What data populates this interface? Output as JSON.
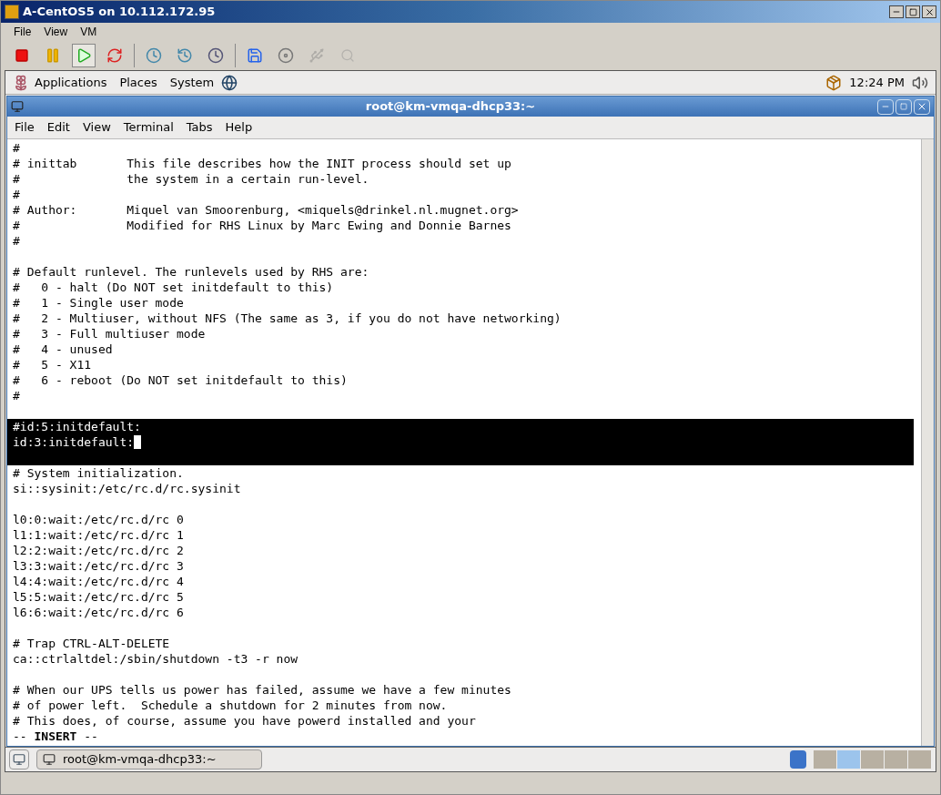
{
  "vm_window": {
    "title": "A-CentOS5 on 10.112.172.95",
    "menu": [
      "File",
      "View",
      "VM"
    ],
    "toolbar": [
      {
        "kind": "stop",
        "selected": false,
        "disabled": false
      },
      {
        "kind": "pause",
        "selected": false,
        "disabled": false
      },
      {
        "kind": "play",
        "selected": true,
        "disabled": false
      },
      {
        "kind": "reset",
        "selected": false,
        "disabled": false
      },
      {
        "kind": "snapshot",
        "selected": false,
        "disabled": false
      },
      {
        "kind": "revert",
        "selected": false,
        "disabled": false
      },
      {
        "kind": "manager",
        "selected": false,
        "disabled": false
      },
      {
        "kind": "settings",
        "selected": false,
        "disabled": false
      },
      {
        "kind": "cd",
        "selected": false,
        "disabled": false
      },
      {
        "kind": "usb",
        "selected": false,
        "disabled": true
      },
      {
        "kind": "zoom",
        "selected": false,
        "disabled": true
      }
    ]
  },
  "top_panel": {
    "menus": [
      "Applications",
      "Places",
      "System"
    ],
    "clock": "12:24 PM"
  },
  "terminal": {
    "title": "root@km-vmqa-dhcp33:~",
    "menu": [
      "File",
      "Edit",
      "View",
      "Terminal",
      "Tabs",
      "Help"
    ],
    "lines": [
      {
        "text": "#",
        "highlighted": false
      },
      {
        "text": "# inittab       This file describes how the INIT process should set up",
        "highlighted": false
      },
      {
        "text": "#               the system in a certain run-level.",
        "highlighted": false
      },
      {
        "text": "#",
        "highlighted": false
      },
      {
        "text": "# Author:       Miquel van Smoorenburg, <miquels@drinkel.nl.mugnet.org>",
        "highlighted": false
      },
      {
        "text": "#               Modified for RHS Linux by Marc Ewing and Donnie Barnes",
        "highlighted": false
      },
      {
        "text": "#",
        "highlighted": false
      },
      {
        "highlighted": false
      },
      {
        "text": "# Default runlevel. The runlevels used by RHS are:",
        "highlighted": false
      },
      {
        "text": "#   0 - halt (Do NOT set initdefault to this)",
        "highlighted": false
      },
      {
        "text": "#   1 - Single user mode",
        "highlighted": false
      },
      {
        "text": "#   2 - Multiuser, without NFS (The same as 3, if you do not have networking)",
        "highlighted": false
      },
      {
        "text": "#   3 - Full multiuser mode",
        "highlighted": false
      },
      {
        "text": "#   4 - unused",
        "highlighted": false
      },
      {
        "text": "#   5 - X11",
        "highlighted": false
      },
      {
        "text": "#   6 - reboot (Do NOT set initdefault to this)",
        "highlighted": false
      },
      {
        "text": "#",
        "highlighted": false
      },
      {
        "highlighted": false
      },
      {
        "text": "#id:5:initdefault:",
        "highlighted": true
      },
      {
        "text": "id:3:initdefault:",
        "highlighted": true,
        "cursor": true
      },
      {
        "highlighted": true
      },
      {
        "text": "# System initialization.",
        "highlighted": false
      },
      {
        "text": "si::sysinit:/etc/rc.d/rc.sysinit",
        "highlighted": false
      },
      {
        "highlighted": false
      },
      {
        "text": "l0:0:wait:/etc/rc.d/rc 0",
        "highlighted": false
      },
      {
        "text": "l1:1:wait:/etc/rc.d/rc 1",
        "highlighted": false
      },
      {
        "text": "l2:2:wait:/etc/rc.d/rc 2",
        "highlighted": false
      },
      {
        "text": "l3:3:wait:/etc/rc.d/rc 3",
        "highlighted": false
      },
      {
        "text": "l4:4:wait:/etc/rc.d/rc 4",
        "highlighted": false
      },
      {
        "text": "l5:5:wait:/etc/rc.d/rc 5",
        "highlighted": false
      },
      {
        "text": "l6:6:wait:/etc/rc.d/rc 6",
        "highlighted": false
      },
      {
        "highlighted": false
      },
      {
        "text": "# Trap CTRL-ALT-DELETE",
        "highlighted": false
      },
      {
        "text": "ca::ctrlaltdel:/sbin/shutdown -t3 -r now",
        "highlighted": false
      },
      {
        "highlighted": false
      },
      {
        "text": "# When our UPS tells us power has failed, assume we have a few minutes",
        "highlighted": false
      },
      {
        "text": "# of power left.  Schedule a shutdown for 2 minutes from now.",
        "highlighted": false
      },
      {
        "text": "# This does, of course, assume you have powerd installed and your",
        "highlighted": false
      },
      {
        "text": "-- **INSERT** --",
        "highlighted": false
      }
    ]
  },
  "bottom_panel": {
    "task": "root@km-vmqa-dhcp33:~",
    "workspaces": [
      {
        "selected": false
      },
      {
        "selected": true
      },
      {
        "selected": false
      },
      {
        "selected": false
      },
      {
        "selected": false
      }
    ]
  }
}
